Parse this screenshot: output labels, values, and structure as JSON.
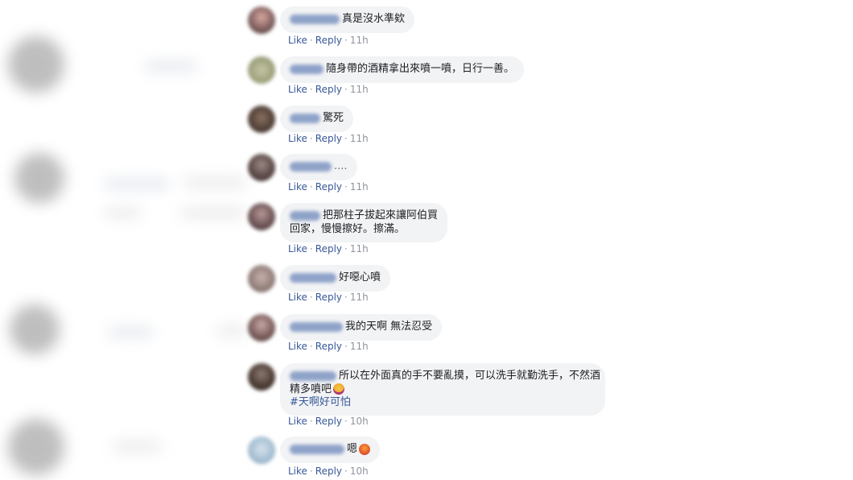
{
  "comments": [
    {
      "text": "真是沒水準欸",
      "like": "Like",
      "reply": "Reply",
      "time": "11h"
    },
    {
      "text": "隨身帶的酒精拿出來噴一噴，日行一善。",
      "like": "Like",
      "reply": "Reply",
      "time": "11h"
    },
    {
      "text": "驚死",
      "like": "Like",
      "reply": "Reply",
      "time": "11h"
    },
    {
      "text": "....",
      "like": "Like",
      "reply": "Reply",
      "time": "11h"
    },
    {
      "line1": "把那柱子拔起來讓阿伯買",
      "line2": "回家，慢慢擦好。擦滿。",
      "like": "Like",
      "reply": "Reply",
      "time": "11h"
    },
    {
      "text": "好噁心噴",
      "like": "Like",
      "reply": "Reply",
      "time": "11h"
    },
    {
      "text": "我的天啊 無法忍受",
      "like": "Like",
      "reply": "Reply",
      "time": "11h"
    },
    {
      "line1": "所以在外面真的手不要亂摸，可以洗手就勤洗手，不然酒",
      "line2": "精多噴吧",
      "hashtag": "#天啊好可怕",
      "emoji": "grimacing-face-emoji",
      "like": "Like",
      "reply": "Reply",
      "time": "10h"
    },
    {
      "text": "嗯",
      "emoji": "angry-face-emoji",
      "like": "Like",
      "reply": "Reply",
      "time": "10h"
    }
  ],
  "colors": {
    "link": "#385898",
    "bubble": "#f2f3f5",
    "timestamp": "#90949c",
    "blurred_name": "#8fa3c9"
  }
}
